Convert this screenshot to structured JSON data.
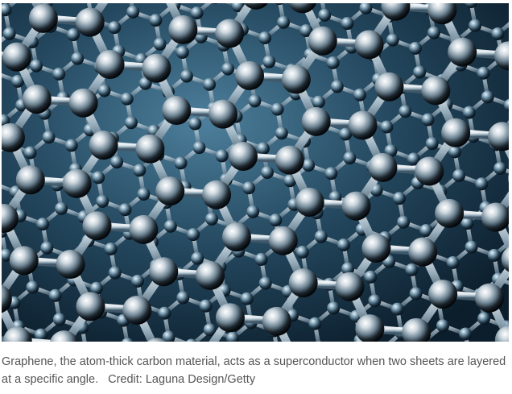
{
  "photo": {
    "subject_icon": "graphene-lattice-icon",
    "colors": {
      "background_light": "#3f6f8c",
      "background_dark": "#0f2536",
      "bond": "#c9d8e2",
      "atom_highlight": "#ffffff",
      "atom_core": "#0b0f14"
    }
  },
  "caption": {
    "text": "Graphene, the atom-thick carbon material, acts as a superconductor when two sheets are layered at a specific angle.",
    "credit": "Credit: Laguna Design/Getty"
  }
}
